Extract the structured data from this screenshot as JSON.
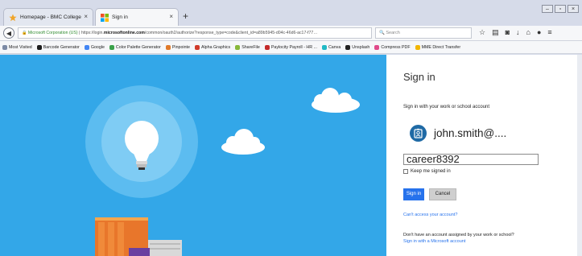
{
  "browser": {
    "tabs": [
      {
        "label": "Homepage - BMC College",
        "active": false,
        "close": "×"
      },
      {
        "label": "Sign in",
        "active": true,
        "close": "×"
      }
    ],
    "new_tab": "+",
    "url": {
      "org": "Microsoft Corporation (US)",
      "prefix": "https://",
      "host_pre": "login.",
      "host": "microsoftonline.com",
      "path": "/common/oauth2/authorize?response_type=code&client_id=a89b5945-d04c-46d6-ac17-f77…"
    },
    "search_placeholder": "Search",
    "bookmarks": [
      {
        "label": "Most Visited",
        "color": "#7c8aa5"
      },
      {
        "label": "Barcode Generator",
        "color": "#1c1c1c"
      },
      {
        "label": "Google",
        "color": "#4285f4"
      },
      {
        "label": "Color Palette Generator",
        "color": "#3aa14a"
      },
      {
        "label": "Pinpointe",
        "color": "#e07a2a"
      },
      {
        "label": "Alpha Graphics",
        "color": "#d03a2a"
      },
      {
        "label": "ShareFile",
        "color": "#88b83a"
      },
      {
        "label": "Paylocity Payroll - HR ...",
        "color": "#c42a2a"
      },
      {
        "label": "Canva",
        "color": "#20b9c5"
      },
      {
        "label": "Unsplash",
        "color": "#222222"
      },
      {
        "label": "Compress PDF",
        "color": "#e04a8a"
      },
      {
        "label": "MME Direct Transfer",
        "color": "#f2b600"
      }
    ]
  },
  "signin": {
    "title": "Sign in",
    "subtitle": "Sign in with your work or school account",
    "account": "john.smith@....",
    "password_value": "career8392",
    "keep_signed_in": "Keep me signed in",
    "signin_button": "Sign in",
    "cancel_button": "Cancel",
    "cant_access": "Can't access your account?",
    "no_account": "Don't have an account assigned by your work or school?",
    "ms_link": "Sign in with a Microsoft account"
  },
  "colors": {
    "hero_bg": "#33a7e8",
    "accent": "#2672ec"
  }
}
